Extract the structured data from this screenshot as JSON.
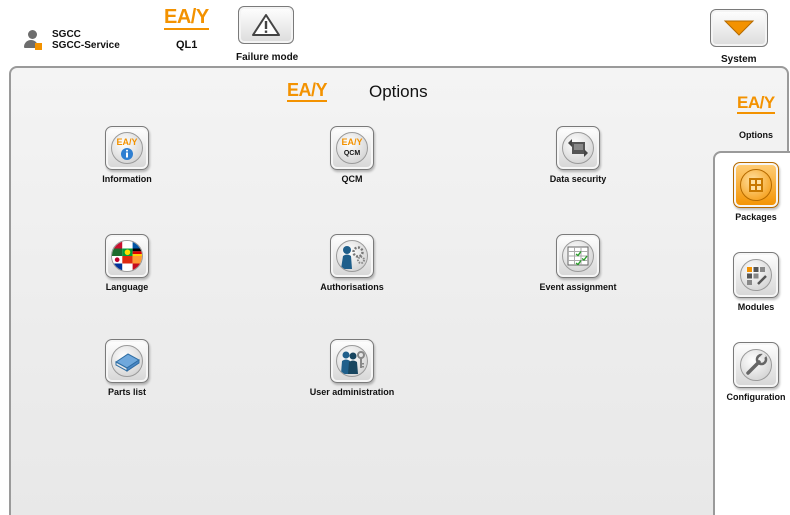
{
  "user": {
    "name": "SGCC",
    "role": "SGCC-Service"
  },
  "header": {
    "logo_text": "EA/Y",
    "ql_label": "QL1",
    "failure_mode_label": "Failure mode",
    "system_label": "System"
  },
  "options": {
    "logo_text": "EA/Y",
    "title": "Options",
    "tiles": [
      {
        "label": "Information",
        "icon": "info-icon"
      },
      {
        "label": "QCM",
        "icon": "qcm-icon",
        "badge": "QCM"
      },
      {
        "label": "Data security",
        "icon": "data-security-icon"
      },
      {
        "label": "Language",
        "icon": "flags-icon"
      },
      {
        "label": "Authorisations",
        "icon": "authorisations-icon"
      },
      {
        "label": "Event assignment",
        "icon": "event-assignment-icon"
      },
      {
        "label": "Parts list",
        "icon": "book-icon"
      },
      {
        "label": "User administration",
        "icon": "user-admin-icon"
      }
    ]
  },
  "side": {
    "logo_text": "EA/Y",
    "options_label": "Options",
    "items": [
      {
        "label": "Packages",
        "icon": "packages-icon",
        "active": true
      },
      {
        "label": "Modules",
        "icon": "modules-icon"
      },
      {
        "label": "Configuration",
        "icon": "wrench-icon"
      }
    ]
  },
  "colors": {
    "brand": "#f39200",
    "border": "#9a9a9a",
    "panel": "#f0f0f0"
  }
}
